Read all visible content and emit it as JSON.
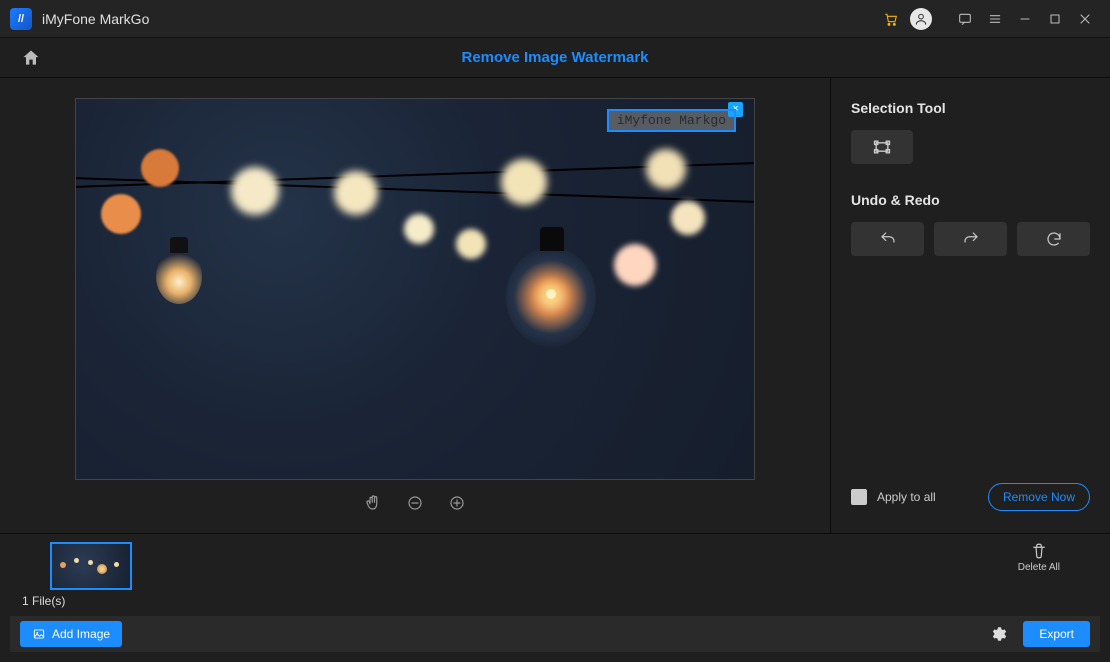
{
  "app": {
    "title": "iMyFone MarkGo"
  },
  "header": {
    "page_title": "Remove Image Watermark"
  },
  "watermark": {
    "text": "iMyfone Markgo"
  },
  "side": {
    "selection_title": "Selection Tool",
    "undo_title": "Undo & Redo",
    "apply_label": "Apply to all",
    "remove_label": "Remove Now"
  },
  "strip": {
    "file_count": "1 File(s)",
    "delete_all": "Delete All"
  },
  "footer": {
    "add_image": "Add Image",
    "export": "Export"
  },
  "icons": {
    "cart": "cart-icon",
    "user": "user-icon",
    "feedback": "feedback-icon",
    "menu": "menu-icon",
    "minimize": "minimize-icon",
    "maximize": "maximize-icon",
    "close": "close-icon",
    "home": "home-icon",
    "hand": "hand-icon",
    "zoom_out": "zoom-out-icon",
    "zoom_in": "zoom-in-icon",
    "rect_select": "rectangle-select-icon",
    "undo": "undo-icon",
    "redo": "redo-icon",
    "refresh": "refresh-icon",
    "trash": "trash-icon",
    "image": "image-icon",
    "gear": "gear-icon"
  }
}
